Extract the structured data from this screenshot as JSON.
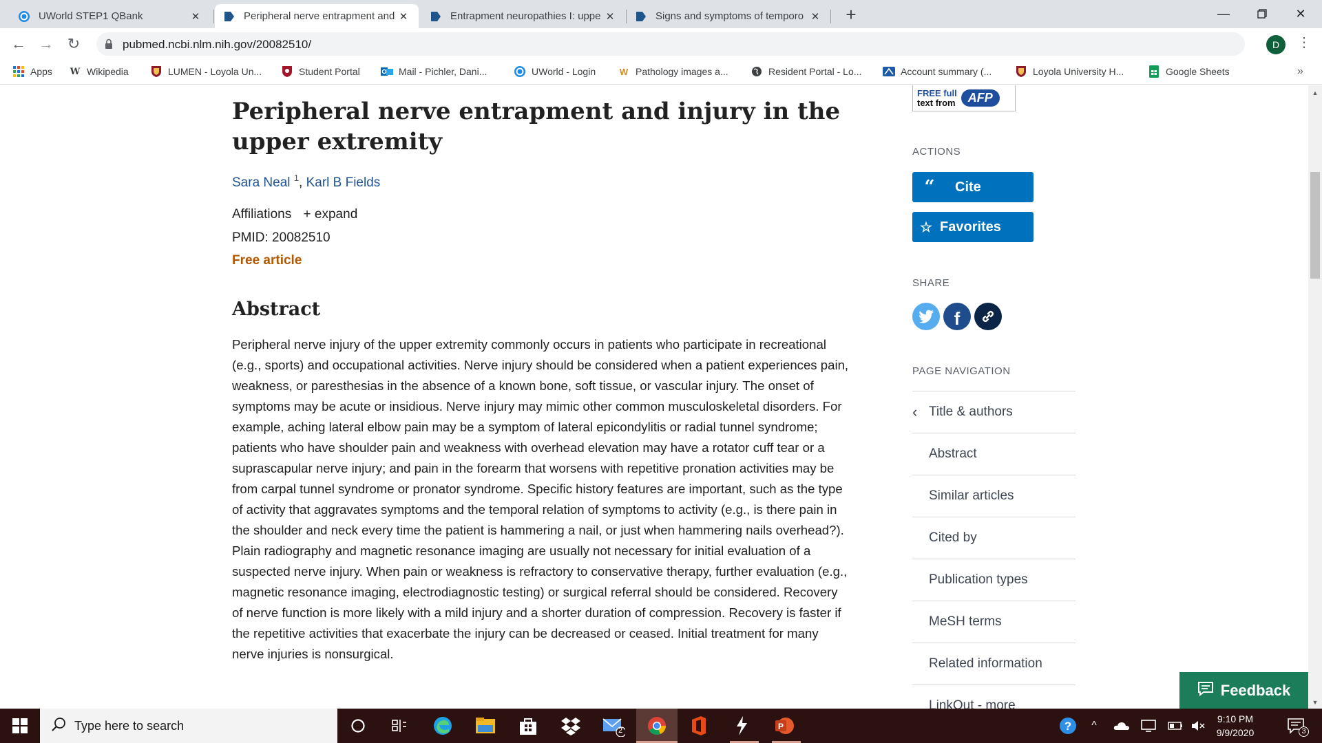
{
  "browser": {
    "tabs": [
      {
        "title": "UWorld STEP1 QBank"
      },
      {
        "title": "Peripheral nerve entrapment and"
      },
      {
        "title": "Entrapment neuropathies I: uppe"
      },
      {
        "title": "Signs and symptoms of temporo"
      }
    ],
    "url": "pubmed.ncbi.nlm.nih.gov/20082510/",
    "profile_initial": "D",
    "bookmarks": [
      {
        "label": "Apps",
        "icon": "apps-grid-icon"
      },
      {
        "label": "Wikipedia",
        "icon": "wikipedia-icon"
      },
      {
        "label": "LUMEN - Loyola Un...",
        "icon": "loyola-shield-icon"
      },
      {
        "label": "Student Portal",
        "icon": "portal-shield-icon"
      },
      {
        "label": "Mail - Pichler, Dani...",
        "icon": "outlook-icon"
      },
      {
        "label": "UWorld - Login",
        "icon": "uworld-icon"
      },
      {
        "label": "Pathology images a...",
        "icon": "pathology-icon"
      },
      {
        "label": "Resident Portal - Lo...",
        "icon": "globe-icon"
      },
      {
        "label": "Account summary (...",
        "icon": "account-icon"
      },
      {
        "label": "Loyola University H...",
        "icon": "loyola-shield-icon"
      },
      {
        "label": "Google Sheets",
        "icon": "sheets-icon"
      }
    ]
  },
  "article": {
    "title": "Peripheral nerve entrapment and injury in the upper extremity",
    "author1": "Sara Neal",
    "author1_sup": "1",
    "author2": "Karl B Fields",
    "affiliations_label": "Affiliations",
    "expand_label": "+ expand",
    "pmid": "PMID: 20082510",
    "free_label": "Free article",
    "abstract_heading": "Abstract",
    "abstract_text": "Peripheral nerve injury of the upper extremity commonly occurs in patients who participate in recreational (e.g., sports) and occupational activities. Nerve injury should be considered when a patient experiences pain, weakness, or paresthesias in the absence of a known bone, soft tissue, or vascular injury. The onset of symptoms may be acute or insidious. Nerve injury may mimic other common musculoskeletal disorders. For example, aching lateral elbow pain may be a symptom of lateral epicondylitis or radial tunnel syndrome; patients who have shoulder pain and weakness with overhead elevation may have a rotator cuff tear or a suprascapular nerve injury; and pain in the forearm that worsens with repetitive pronation activities may be from carpal tunnel syndrome or pronator syndrome. Specific history features are important, such as the type of activity that aggravates symptoms and the temporal relation of symptoms to activity (e.g., is there pain in the shoulder and neck every time the patient is hammering a nail, or just when hammering nails overhead?). Plain radiography and magnetic resonance imaging are usually not necessary for initial evaluation of a suspected nerve injury. When pain or weakness is refractory to conservative therapy, further evaluation (e.g., magnetic resonance imaging, electrodiagnostic testing) or surgical referral should be considered. Recovery of nerve function is more likely with a mild injury and a shorter duration of compression. Recovery is faster if the repetitive activities that exacerbate the injury can be decreased or ceased. Initial treatment for many nerve injuries is nonsurgical."
  },
  "sidebar": {
    "afp_free": "FREE full",
    "afp_text_from": "text from",
    "afp_logo": "AFP",
    "actions_heading": "ACTIONS",
    "cite_label": "Cite",
    "favorites_label": "Favorites",
    "share_heading": "SHARE",
    "page_nav_heading": "PAGE NAVIGATION",
    "nav_items": [
      {
        "label": "Title & authors"
      },
      {
        "label": "Abstract"
      },
      {
        "label": "Similar articles"
      },
      {
        "label": "Cited by"
      },
      {
        "label": "Publication types"
      },
      {
        "label": "MeSH terms"
      },
      {
        "label": "Related information"
      },
      {
        "label": "LinkOut - more"
      }
    ],
    "feedback_label": "Feedback"
  },
  "taskbar": {
    "search_placeholder": "Type here to search",
    "time": "9:10 PM",
    "date": "9/9/2020",
    "mail_badge": "2",
    "notification_count": "3"
  },
  "colors": {
    "link": "#205493",
    "free_article": "#b25800",
    "action_button": "#0071bc",
    "feedback": "#1b7d5a",
    "taskbar": "#2b1210"
  }
}
